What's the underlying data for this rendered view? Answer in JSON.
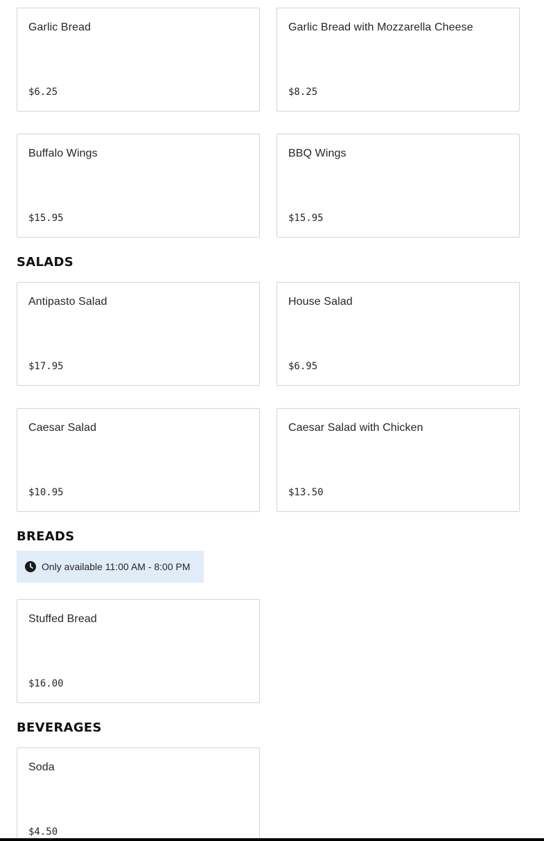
{
  "sections": {
    "appetizers": {
      "items": [
        {
          "name": "Garlic Bread",
          "price": "$6.25"
        },
        {
          "name": "Garlic Bread with Mozzarella Cheese",
          "price": "$8.25"
        },
        {
          "name": "Buffalo Wings",
          "price": "$15.95"
        },
        {
          "name": "BBQ Wings",
          "price": "$15.95"
        }
      ]
    },
    "salads": {
      "title": "SALADS",
      "items": [
        {
          "name": "Antipasto Salad",
          "price": "$17.95"
        },
        {
          "name": "House Salad",
          "price": "$6.95"
        },
        {
          "name": "Caesar Salad",
          "price": "$10.95"
        },
        {
          "name": "Caesar Salad with Chicken",
          "price": "$13.50"
        }
      ]
    },
    "breads": {
      "title": "BREADS",
      "availability": {
        "icon": "clock-icon",
        "text": "Only available 11:00 AM - 8:00 PM"
      },
      "items": [
        {
          "name": "Stuffed Bread",
          "price": "$16.00"
        }
      ]
    },
    "beverages": {
      "title": "BEVERAGES",
      "items": [
        {
          "name": "Soda",
          "price": "$4.50"
        }
      ]
    }
  },
  "colors": {
    "card_border": "#d4d4d4",
    "availability_bg": "#e1ecf9",
    "text": "#262626",
    "heading": "#111111"
  }
}
